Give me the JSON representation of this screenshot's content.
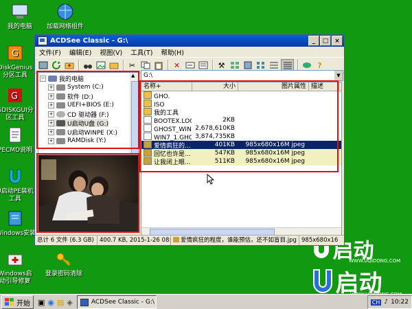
{
  "desktop": {
    "icons": [
      {
        "label": "我的电脑"
      },
      {
        "label": "加载网络组件"
      },
      {
        "label": "DiskGenius分区工具"
      },
      {
        "label": "GDISKGUI分区工具"
      },
      {
        "label": "PECMD说明"
      },
      {
        "label": "U启动PE装机工具"
      },
      {
        "label": "Windows安装"
      },
      {
        "label": "Windows启动引导修复"
      },
      {
        "label": "登录密码清除"
      }
    ]
  },
  "window": {
    "title": "ACDSee Classic - G:\\",
    "menu": [
      "文件(F)",
      "编辑(E)",
      "视图(V)",
      "工具(T)",
      "帮助(H)"
    ],
    "path": "G:\\"
  },
  "tree": {
    "items": [
      {
        "label": "我的电脑",
        "icon": "computer-icon",
        "color": "#6b7fb0"
      },
      {
        "label": "System (C:)",
        "icon": "drive-icon",
        "color": "#8a8a8a"
      },
      {
        "label": "软件 (D:)",
        "icon": "drive-icon",
        "color": "#8a8a8a"
      },
      {
        "label": "UEFI+BIOS (E:)",
        "icon": "drive-icon",
        "color": "#8a8a8a"
      },
      {
        "label": "CD 驱动器 (F:)",
        "icon": "cd-icon",
        "color": "#b0b0b0"
      },
      {
        "label": "U启动U盘 (G:)",
        "icon": "usb-icon",
        "color": "#555555"
      },
      {
        "label": "U启动WINPE (X:)",
        "icon": "drive-icon",
        "color": "#8a8a8a"
      },
      {
        "label": "RAMDisk (Y:)",
        "icon": "drive-icon",
        "color": "#8a8a8a"
      }
    ]
  },
  "filelist": {
    "columns": [
      "名称+",
      "大小",
      "图片属性",
      "描述"
    ],
    "rows": [
      {
        "name": "GHO.",
        "size": "",
        "props": "",
        "type": "folder"
      },
      {
        "name": "ISO",
        "size": "",
        "props": "",
        "type": "folder"
      },
      {
        "name": "我的工具",
        "size": "",
        "props": "",
        "type": "folder"
      },
      {
        "name": "BOOTEX.LOG",
        "size": "2KB",
        "props": "",
        "type": "file"
      },
      {
        "name": "GHOST_WIN...",
        "size": "2,678,610KB",
        "props": "",
        "type": "file"
      },
      {
        "name": "WIN7_1.GHO",
        "size": "3,874,735KB",
        "props": "",
        "type": "file"
      },
      {
        "name": "爱情疯狂的...",
        "size": "401KB",
        "props": "985x680x16M jpeg",
        "type": "image"
      },
      {
        "name": "回忆也许是...",
        "size": "547KB",
        "props": "985x680x16M jpeg",
        "type": "image"
      },
      {
        "name": "让我闭上眼...",
        "size": "511KB",
        "props": "985x680x16M jpeg",
        "type": "image"
      }
    ]
  },
  "statusbar": {
    "total": "总计 6 文件 (6.3 GB)",
    "info": "400.7 KB, 2015-1-26 08:50",
    "filename": "爱情疯狂的程度，谁能预估，还不如盲目.jpg",
    "dims": "985x680x16M"
  },
  "brand": {
    "name": "启动",
    "url": "WWW.UQIDONG.COM"
  },
  "taskbar": {
    "start": "开始",
    "task": "ACDSee Classic - G:\\",
    "lang": "CH",
    "time": "10:22"
  },
  "colors": {
    "desktop": "#119a11",
    "title_bar": "#0a5fd8",
    "selection": "#0a246a",
    "highlight_box": "#e01010"
  }
}
